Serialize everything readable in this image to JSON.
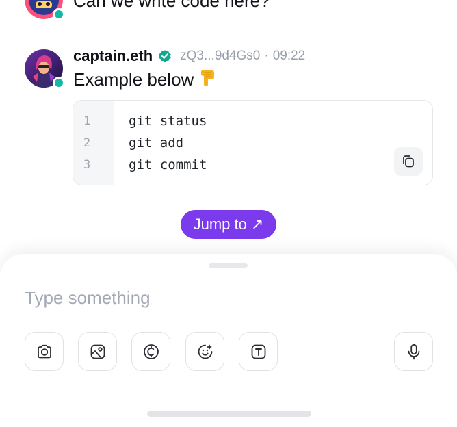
{
  "previous_message": {
    "text": "Can we write code here?",
    "online": true
  },
  "message": {
    "author": "captain.eth",
    "verified": true,
    "address": "zQ3...9d4Gs0",
    "separator": "·",
    "time": "09:22",
    "text": "Example below",
    "emoji": "pointing-down-hand",
    "online": true,
    "code": {
      "line_numbers": [
        "1",
        "2",
        "3"
      ],
      "lines": [
        "git status",
        "git add",
        "git commit"
      ],
      "copy_icon": "copy-icon"
    }
  },
  "jump_button": {
    "label": "Jump to ↗"
  },
  "composer": {
    "placeholder": "Type something",
    "tools": [
      "camera-icon",
      "image-icon",
      "coin-icon",
      "sticker-icon",
      "text-format-icon"
    ],
    "mic_icon": "microphone-icon"
  },
  "colors": {
    "accent": "#7c3aed",
    "online": "#14b8a6",
    "verified": "#14a78f",
    "muted": "#9aa0ab"
  }
}
